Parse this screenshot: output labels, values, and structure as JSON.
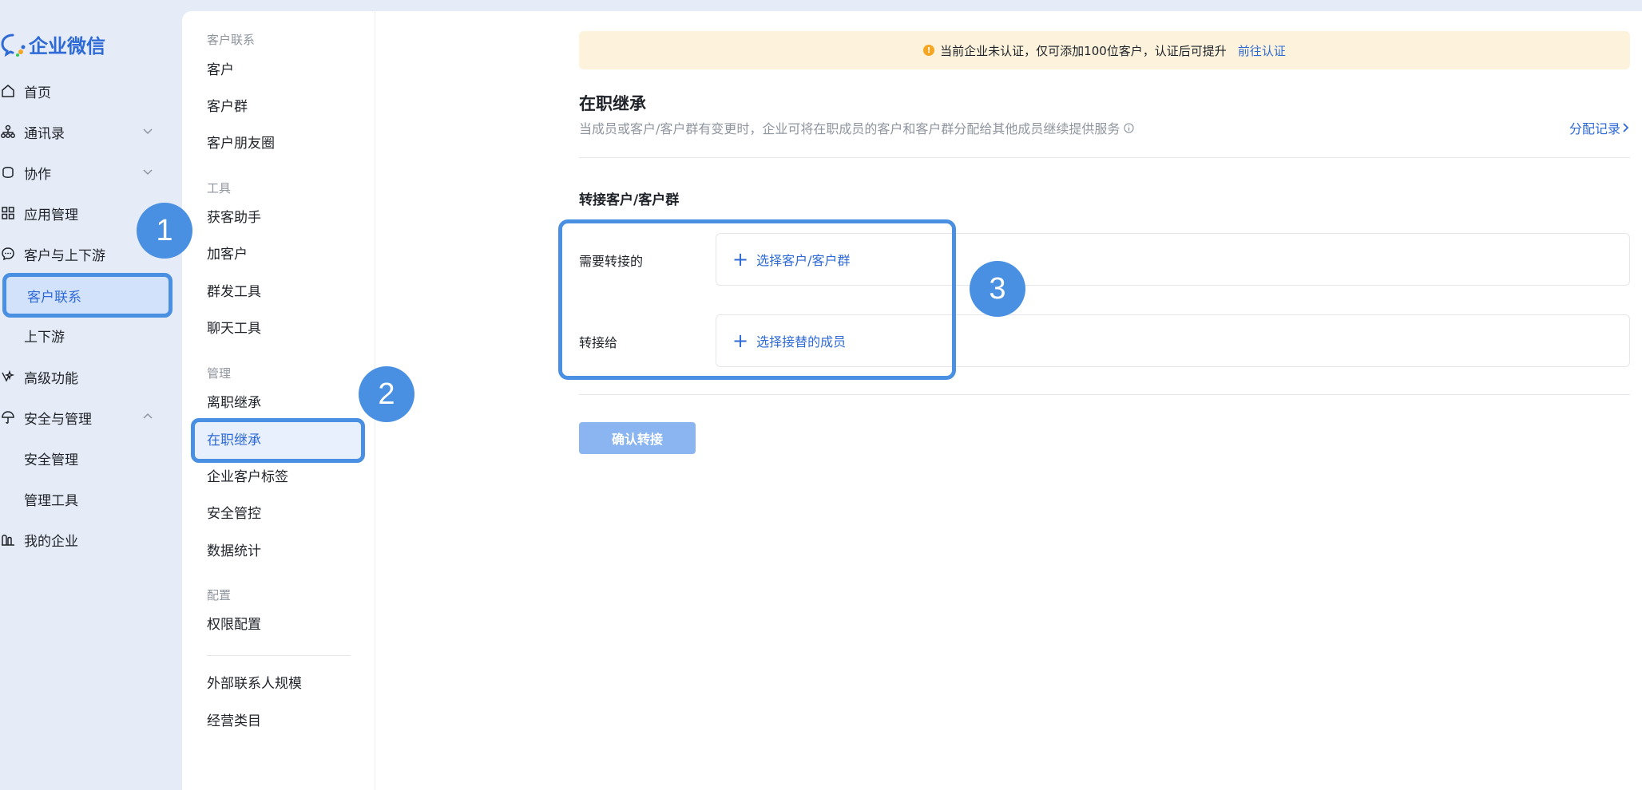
{
  "brand": {
    "name": "企业微信"
  },
  "sidebar": {
    "items": [
      {
        "label": "首页",
        "icon": "home-icon"
      },
      {
        "label": "通讯录",
        "icon": "org-icon"
      },
      {
        "label": "协作",
        "icon": "collab-icon"
      },
      {
        "label": "应用管理",
        "icon": "grid-icon"
      },
      {
        "label": "客户与上下游",
        "icon": "chat-icon"
      },
      {
        "label": "客户联系"
      },
      {
        "label": "上下游"
      },
      {
        "label": "高级功能",
        "icon": "star-icon"
      },
      {
        "label": "安全与管理",
        "icon": "umbrella-icon"
      },
      {
        "label": "安全管理"
      },
      {
        "label": "管理工具"
      },
      {
        "label": "我的企业",
        "icon": "building-icon"
      }
    ]
  },
  "subnav": {
    "groups": [
      {
        "title": "客户联系",
        "items": [
          "客户",
          "客户群",
          "客户朋友圈"
        ]
      },
      {
        "title": "工具",
        "items": [
          "获客助手",
          "加客户",
          "群发工具",
          "聊天工具"
        ]
      },
      {
        "title": "管理",
        "items": [
          "离职继承",
          "在职继承",
          "企业客户标签",
          "安全管控",
          "数据统计"
        ]
      },
      {
        "title": "配置",
        "items": [
          "权限配置"
        ]
      }
    ],
    "extra_items": [
      "外部联系人规模",
      "经营类目"
    ]
  },
  "notice": {
    "text": "当前企业未认证，仅可添加100位客户，认证后可提升",
    "link": "前往认证"
  },
  "main": {
    "title": "在职继承",
    "description": "当成员或客户/客户群有变更时，企业可将在职成员的客户和客户群分配给其他成员继续提供服务",
    "record_link": "分配记录",
    "section_title": "转接客户/客户群",
    "rows": [
      {
        "label": "需要转接的",
        "action": "选择客户/客户群"
      },
      {
        "label": "转接给",
        "action": "选择接替的成员"
      }
    ],
    "confirm_button": "确认转接"
  },
  "annotations": {
    "badges": [
      "1",
      "2",
      "3"
    ]
  },
  "colors": {
    "accent": "#2e6ad6",
    "highlight": "#4a90e2",
    "notice_bg": "#fdf3dc",
    "sidebar_bg": "#e6ecf7"
  }
}
